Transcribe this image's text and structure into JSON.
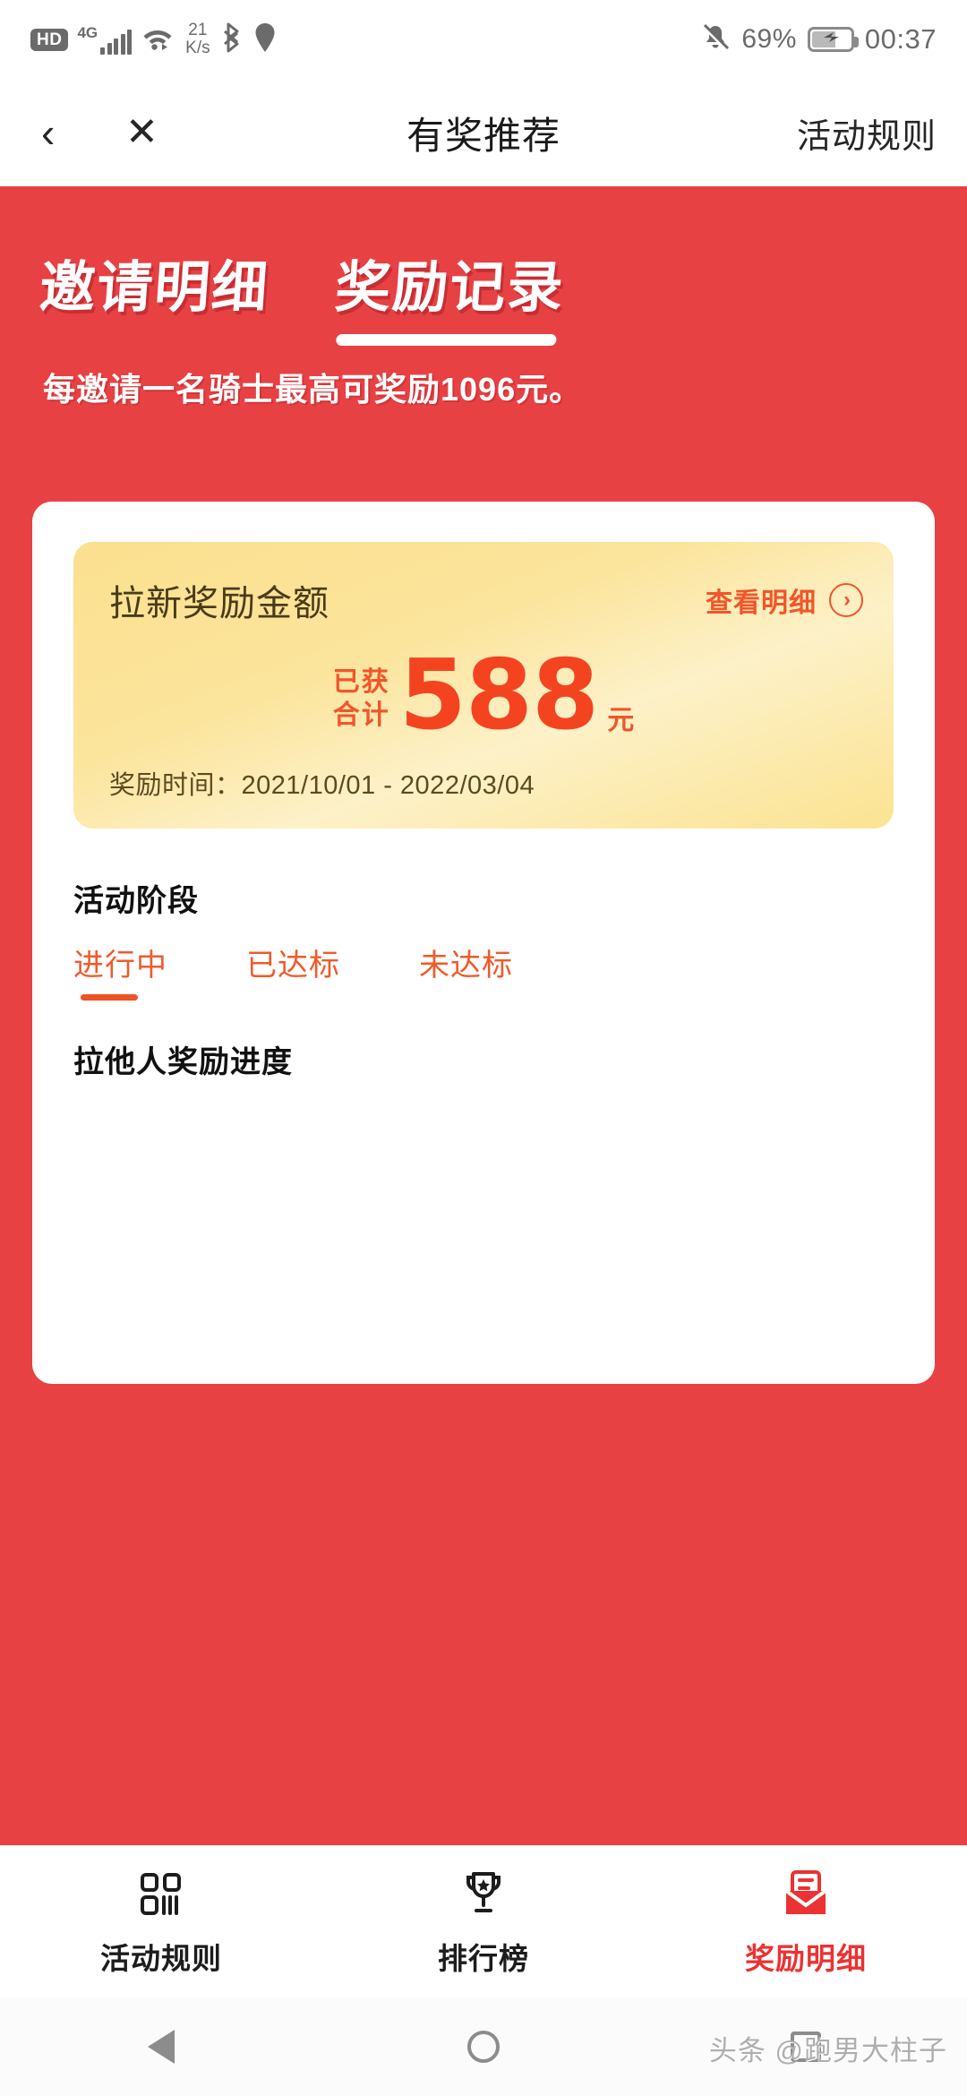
{
  "status_bar": {
    "hd_label": "HD",
    "network_type": "4G",
    "net_speed_value": "21",
    "net_speed_unit": "K/s",
    "bluetooth_icon": "bluetooth-icon",
    "location_icon": "location-pin-icon",
    "mute_icon": "bell-muted-icon",
    "battery_percent": "69%",
    "charging_icon": "charging-bolt-icon",
    "clock": "00:37"
  },
  "nav_bar": {
    "back_icon": "‹",
    "close_icon": "✕",
    "title": "有奖推荐",
    "right_action": "活动规则"
  },
  "hero": {
    "tabs": [
      {
        "label": "邀请明细",
        "active": false
      },
      {
        "label": "奖励记录",
        "active": true
      }
    ],
    "subtitle": "每邀请一名骑士最高可奖励1096元。"
  },
  "reward_card": {
    "title": "拉新奖励金额",
    "detail_link": "查看明细",
    "detail_arrow": "›",
    "prefix_line1": "已获",
    "prefix_line2": "合计",
    "amount": "588",
    "unit": "元",
    "date_label": "奖励时间：",
    "date_range": "2021/10/01 - 2022/03/04"
  },
  "stage_section": {
    "title": "活动阶段",
    "tabs": [
      {
        "label": "进行中",
        "active": true
      },
      {
        "label": "已达标",
        "active": false
      },
      {
        "label": "未达标",
        "active": false
      }
    ]
  },
  "progress_section": {
    "title": "拉他人奖励进度"
  },
  "tab_bar": [
    {
      "label": "活动规则",
      "icon": "grid-rules-icon",
      "active": false
    },
    {
      "label": "排行榜",
      "icon": "trophy-icon",
      "active": false
    },
    {
      "label": "奖励明细",
      "icon": "reward-detail-icon",
      "active": true
    }
  ],
  "android_nav": {
    "back": "back-triangle-icon",
    "home": "home-circle-icon",
    "recents": "recents-square-icon"
  },
  "watermark": "头条 @跑男大柱子",
  "colors": {
    "brand_red": "#e84144",
    "accent_orange": "#f2552a",
    "amount_red": "#f4441f",
    "card_yellow": "#fbe49c",
    "tab_active_red": "#ec3232"
  }
}
